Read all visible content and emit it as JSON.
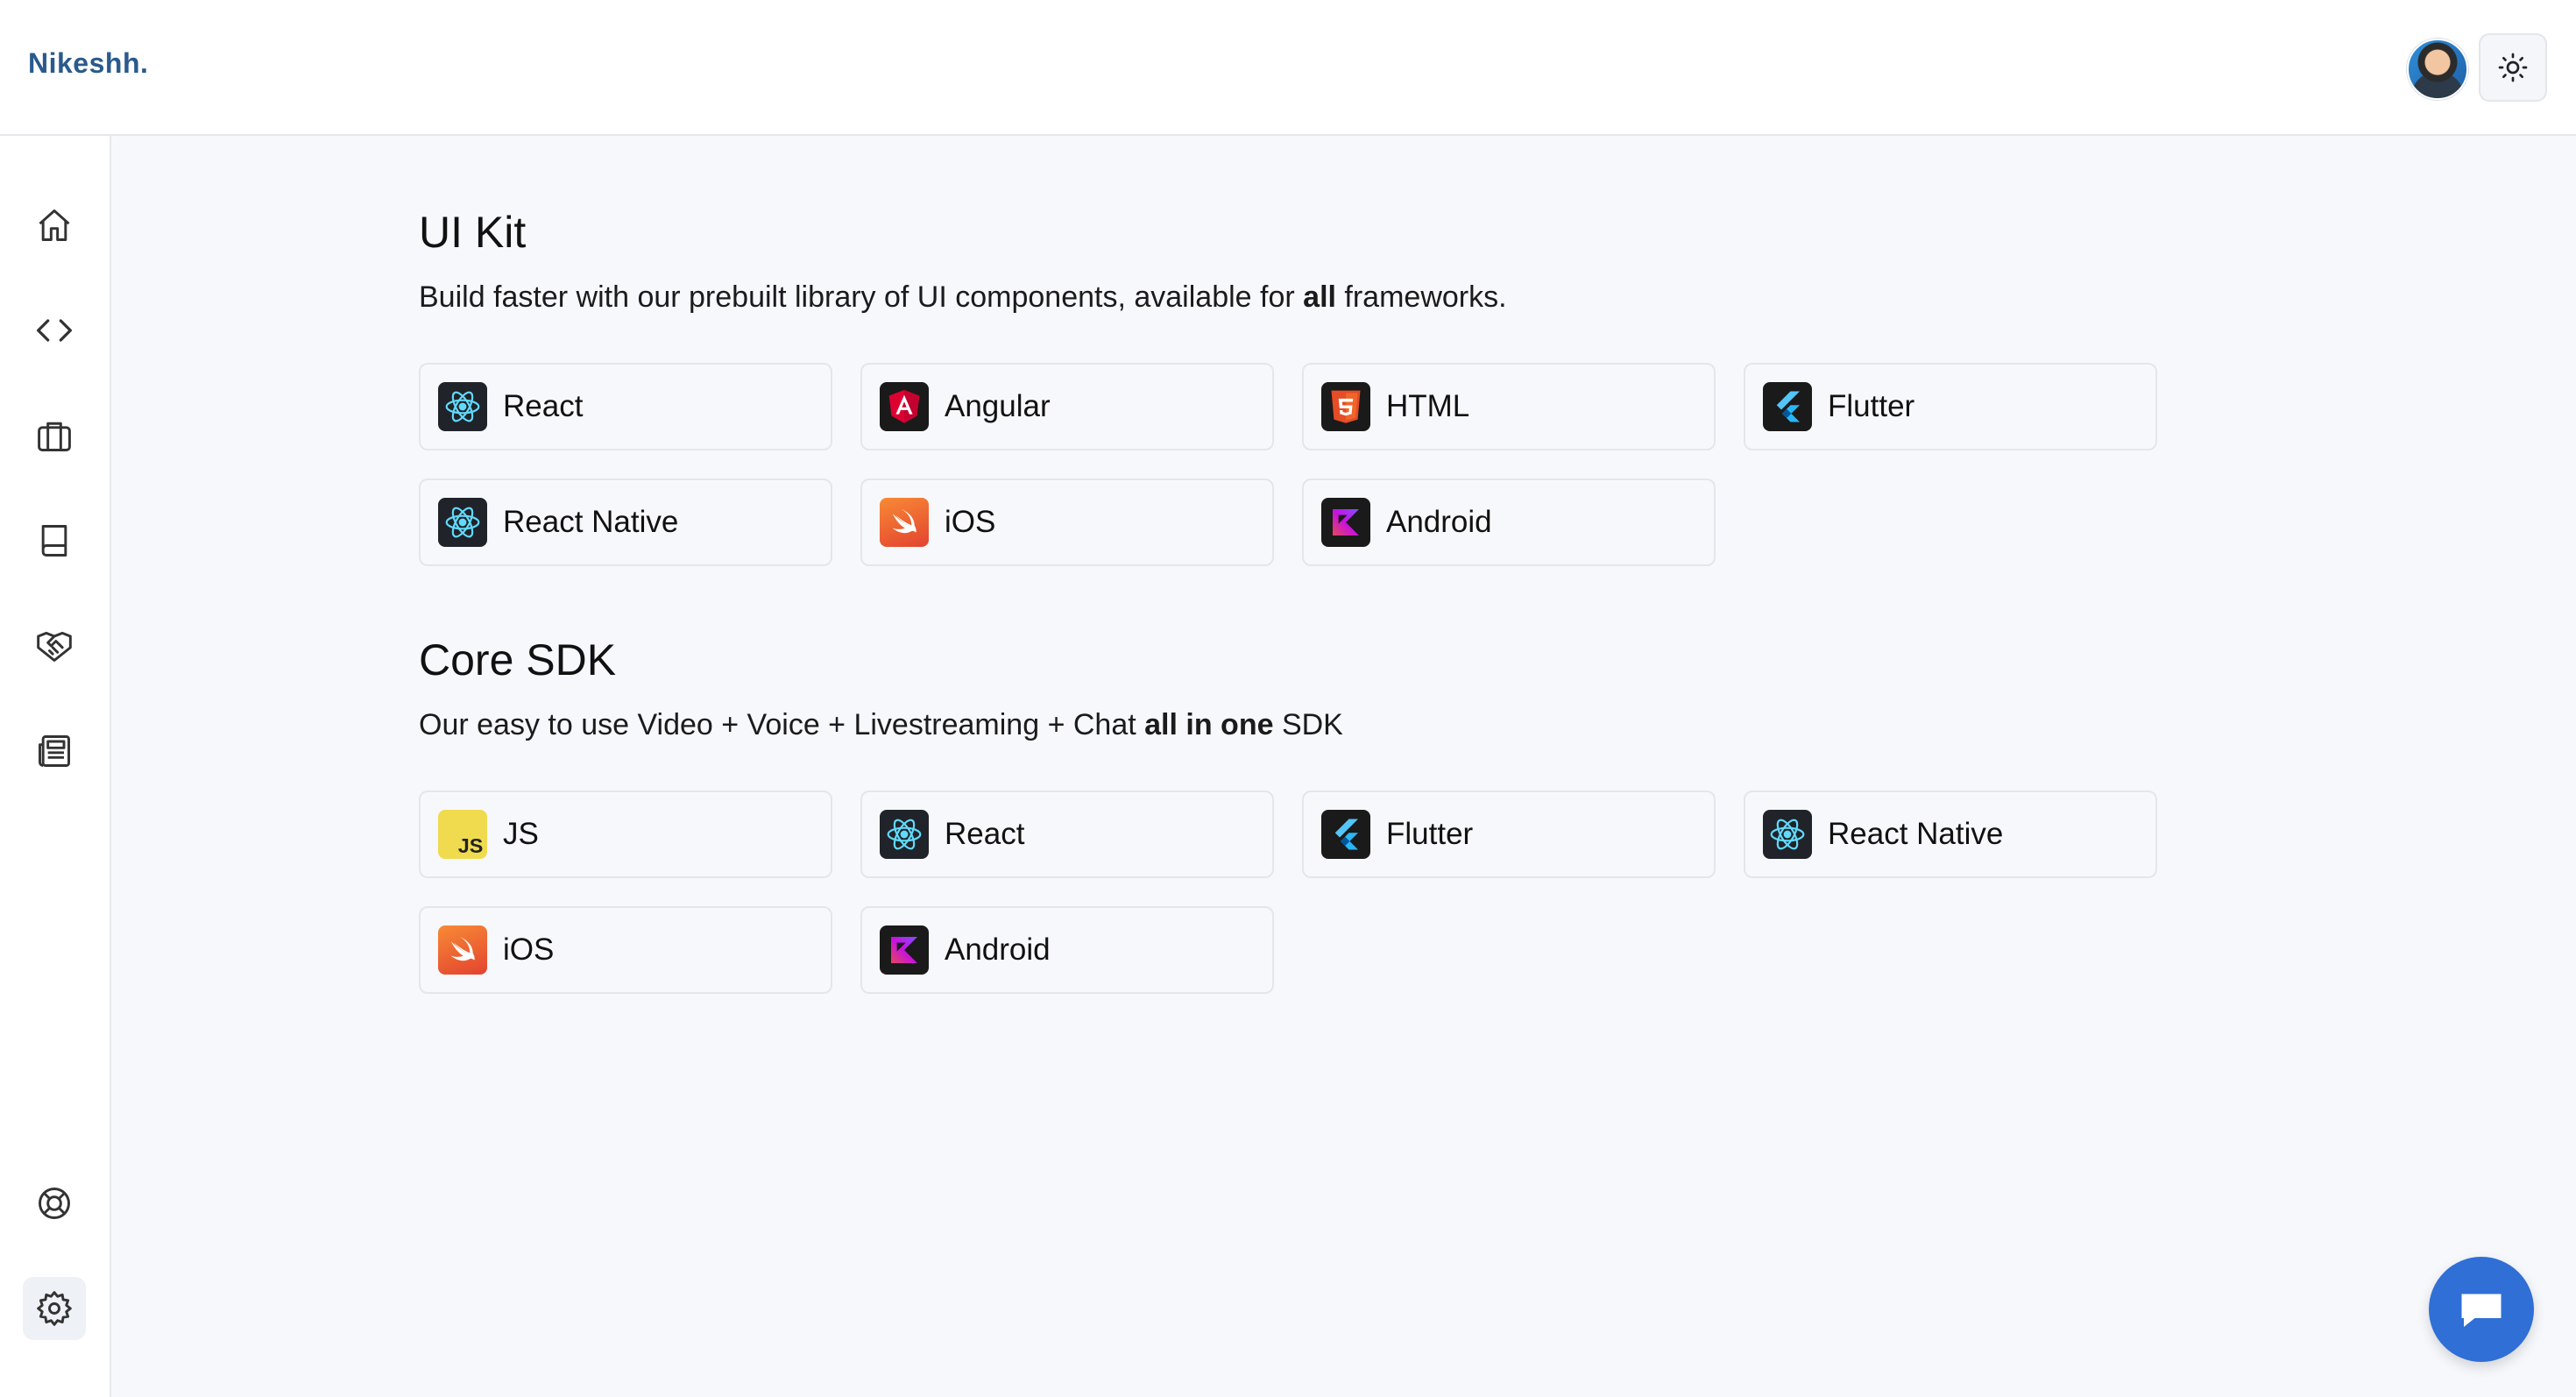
{
  "header": {
    "brand": "Nikeshh."
  },
  "sidebar": {
    "items": [
      {
        "icon": "home-icon"
      },
      {
        "icon": "code-icon"
      },
      {
        "icon": "briefcase-icon"
      },
      {
        "icon": "book-icon"
      },
      {
        "icon": "handshake-icon"
      },
      {
        "icon": "newspaper-icon"
      },
      {
        "icon": "lifebuoy-icon"
      },
      {
        "icon": "gear-icon"
      }
    ]
  },
  "ui_kit": {
    "title": "UI Kit",
    "desc_before": "Build faster with our prebuilt library of UI components, available for ",
    "desc_bold": "all",
    "desc_after": " frameworks.",
    "items": [
      {
        "label": "React",
        "icon": "react-icon"
      },
      {
        "label": "Angular",
        "icon": "angular-icon"
      },
      {
        "label": "HTML",
        "icon": "html5-icon"
      },
      {
        "label": "Flutter",
        "icon": "flutter-icon"
      },
      {
        "label": "React Native",
        "icon": "react-icon"
      },
      {
        "label": "iOS",
        "icon": "swift-icon"
      },
      {
        "label": "Android",
        "icon": "kotlin-icon"
      }
    ]
  },
  "core_sdk": {
    "title": "Core SDK",
    "desc_before": "Our easy to use Video + Voice + Livestreaming + Chat ",
    "desc_bold": "all in one",
    "desc_after": " SDK",
    "items": [
      {
        "label": "JS",
        "icon": "javascript-icon"
      },
      {
        "label": "React",
        "icon": "react-icon"
      },
      {
        "label": "Flutter",
        "icon": "flutter-icon"
      },
      {
        "label": "React Native",
        "icon": "react-icon"
      },
      {
        "label": "iOS",
        "icon": "swift-icon"
      },
      {
        "label": "Android",
        "icon": "kotlin-icon"
      }
    ]
  },
  "colors": {
    "brand": "#2a5a8c",
    "accent": "#2f6fd6",
    "background": "#f6f8fc"
  }
}
